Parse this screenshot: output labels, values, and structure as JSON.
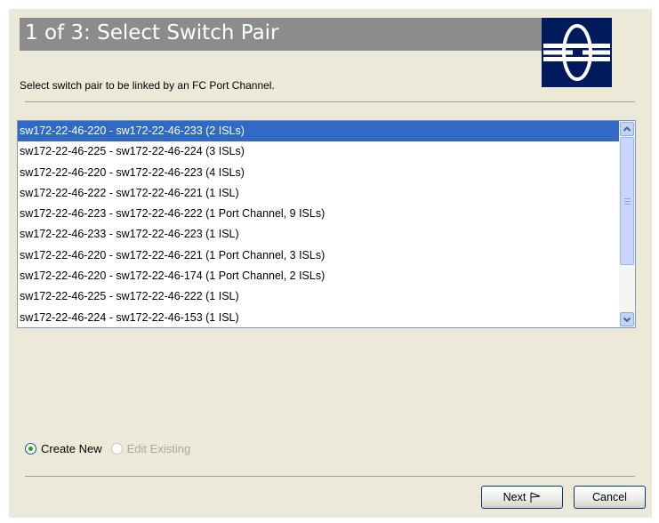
{
  "header": {
    "title": "1 of 3: Select Switch Pair",
    "subtitle": "Select switch pair to be linked by an FC Port Channel."
  },
  "switch_pairs": [
    "sw172-22-46-220 - sw172-22-46-233 (2 ISLs)",
    "sw172-22-46-225 - sw172-22-46-224 (3 ISLs)",
    "sw172-22-46-220 - sw172-22-46-223 (4 ISLs)",
    "sw172-22-46-222 - sw172-22-46-221 (1 ISL)",
    "sw172-22-46-223 - sw172-22-46-222 (1 Port Channel, 9 ISLs)",
    "sw172-22-46-233 - sw172-22-46-223 (1 ISL)",
    "sw172-22-46-220 - sw172-22-46-221 (1 Port Channel, 3 ISLs)",
    "sw172-22-46-220 - sw172-22-46-174 (1 Port Channel, 2 ISLs)",
    "sw172-22-46-225 - sw172-22-46-222 (1 ISL)",
    "sw172-22-46-224 - sw172-22-46-153 (1 ISL)"
  ],
  "selected_index": 0,
  "mode": {
    "create_new": "Create New",
    "edit_existing": "Edit Existing",
    "selected": "create_new"
  },
  "buttons": {
    "next": "Next",
    "cancel": "Cancel"
  },
  "colors": {
    "selection": "#316ac5",
    "logo_bg": "#001a5e",
    "title_bg": "#8c8c8c"
  },
  "icons": {
    "logo": "cisco-bridge-logo-icon",
    "next": "flag-icon"
  }
}
